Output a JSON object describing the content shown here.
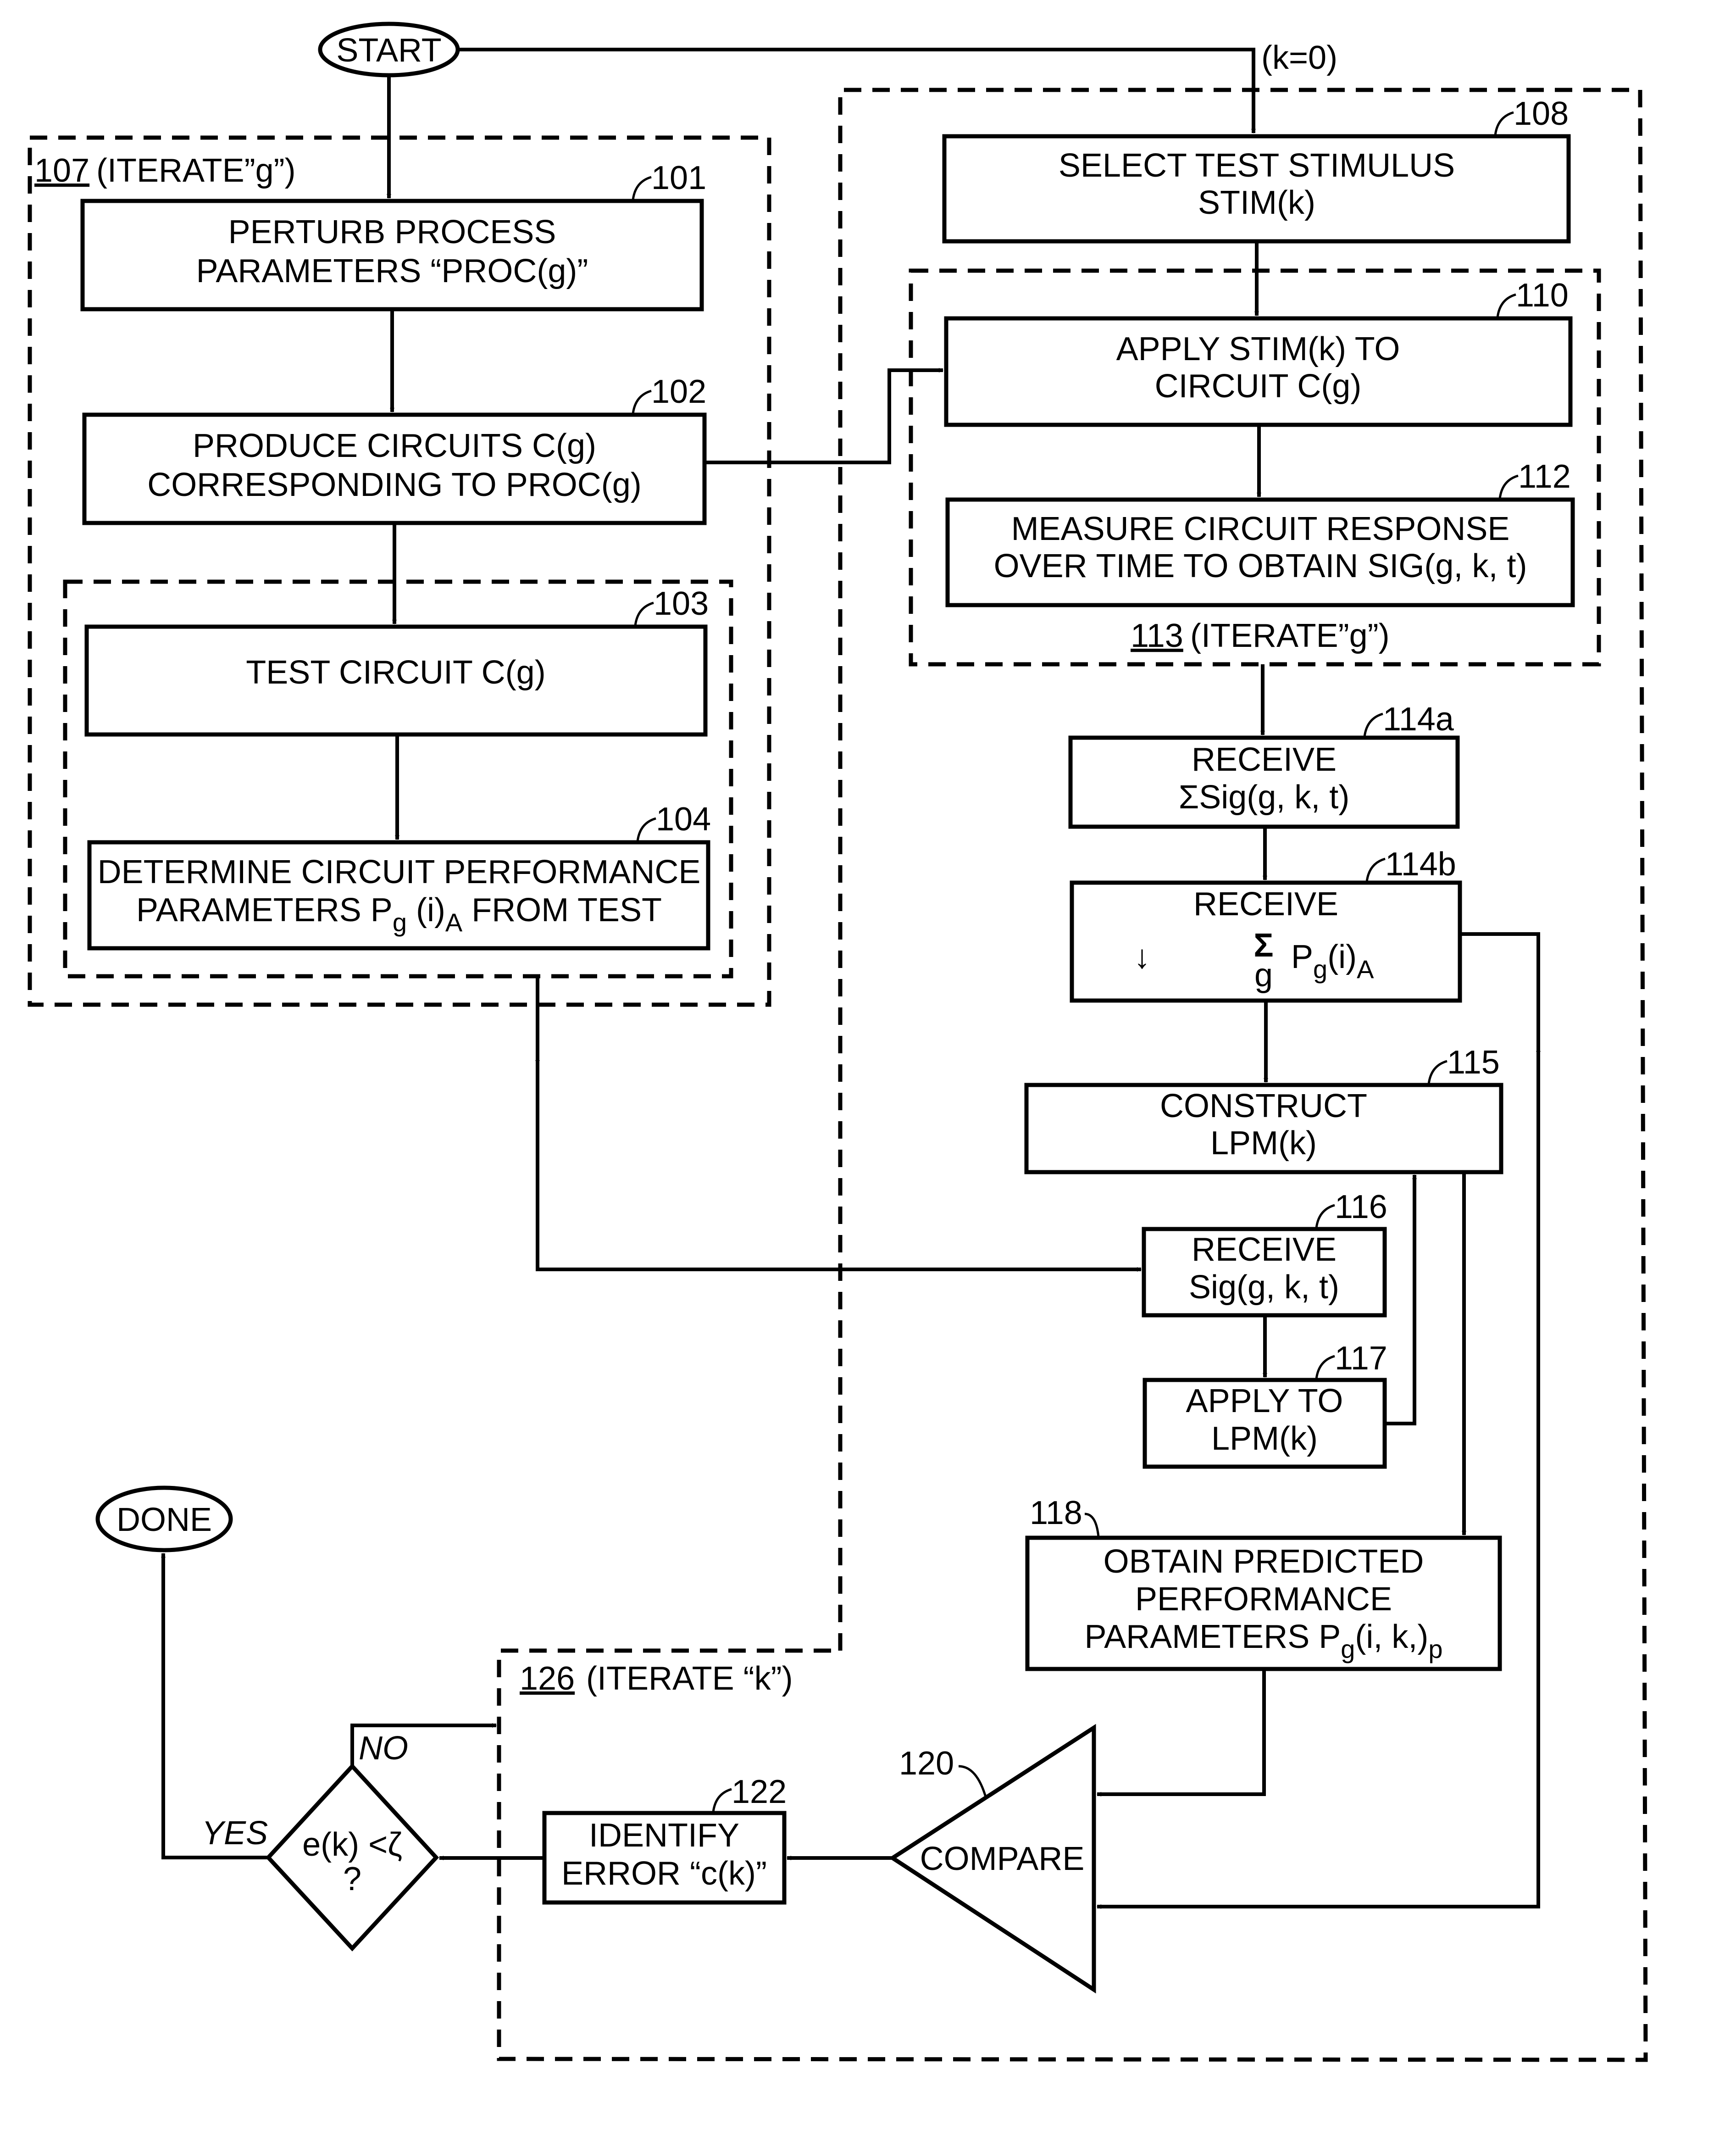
{
  "figure": {
    "start_label": "START",
    "done_label": "DONE",
    "k_init_label": "(k=0)",
    "regions": {
      "r107": {
        "ref": "107",
        "label": "(ITERATE”g”)"
      },
      "r113": {
        "ref": "113",
        "label": "(ITERATE”g”)"
      },
      "r126": {
        "ref": "126",
        "label": "(ITERATE “k”)"
      }
    },
    "steps": {
      "s101": {
        "ref": "101",
        "lines": [
          "PERTURB PROCESS",
          "PARAMETERS “PROC(g)”"
        ]
      },
      "s102": {
        "ref": "102",
        "lines": [
          "PRODUCE CIRCUITS C(g)",
          "CORRESPONDING TO PROC(g)"
        ]
      },
      "s103": {
        "ref": "103",
        "lines": [
          "TEST CIRCUIT C(g)"
        ]
      },
      "s104": {
        "ref": "104",
        "line1": "DETERMINE CIRCUIT PERFORMANCE",
        "line2_pre": "PARAMETERS P",
        "line2_sub": "g",
        "line2_mid": " (i)",
        "line2_sub2": "A",
        "line2_post": " FROM TEST"
      },
      "s108": {
        "ref": "108",
        "lines": [
          "SELECT TEST STIMULUS",
          "STIM(k)"
        ]
      },
      "s110": {
        "ref": "110",
        "lines": [
          "APPLY STIM(k) TO",
          "CIRCUIT C(g)"
        ]
      },
      "s112": {
        "ref": "112",
        "lines": [
          "MEASURE CIRCUIT RESPONSE",
          "OVER TIME TO OBTAIN SIG(g, k, t)"
        ]
      },
      "s114a": {
        "ref": "114a",
        "lines": [
          "RECEIVE",
          "ΣSig(g, k, t)"
        ]
      },
      "s114b": {
        "ref": "114b",
        "line1": "RECEIVE",
        "sigma": "Σ",
        "sigma_sub": "g",
        "expr_pre": "P",
        "expr_sub": "g",
        "expr_mid": "(i)",
        "expr_sub2": "A",
        "down_arrow": "↓"
      },
      "s115": {
        "ref": "115",
        "lines": [
          "CONSTRUCT",
          "LPM(k)"
        ]
      },
      "s116": {
        "ref": "116",
        "lines": [
          "RECEIVE",
          "Sig(g, k, t)"
        ]
      },
      "s117": {
        "ref": "117",
        "lines": [
          "APPLY TO",
          "LPM(k)"
        ]
      },
      "s118": {
        "ref": "118",
        "line1": "OBTAIN PREDICTED",
        "line2": "PERFORMANCE",
        "line3_pre": "PARAMETERS P",
        "line3_sub": "g",
        "line3_mid": "(i, k,)",
        "line3_sub2": "p"
      },
      "s120": {
        "ref": "120",
        "label": "COMPARE"
      },
      "s122": {
        "ref": "122",
        "lines": [
          "IDENTIFY",
          "ERROR “c(k)”"
        ]
      },
      "decision": {
        "line1": "e(k) <ζ",
        "line2": "?",
        "yes_label": "YES",
        "no_label": "NO"
      }
    }
  }
}
